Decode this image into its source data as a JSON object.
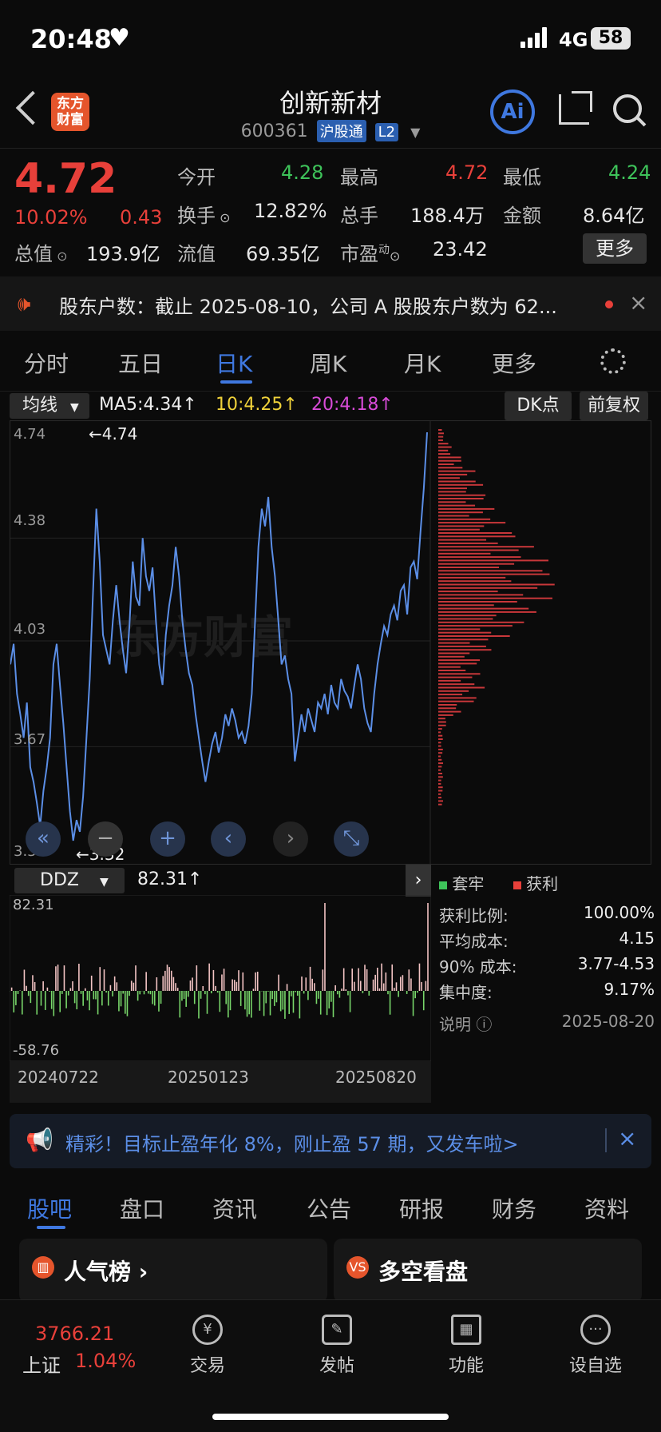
{
  "status": {
    "time": "20:48",
    "network": "4G",
    "battery": "58"
  },
  "header": {
    "name": "创新新材",
    "code": "600361",
    "badge1": "沪股通",
    "badge2": "L2",
    "logo_line1": "东方",
    "logo_line2": "财富",
    "ai_label": "Ai"
  },
  "quote": {
    "price": "4.72",
    "change_pct": "10.02%",
    "change": "0.43",
    "open_label": "今开",
    "open": "4.28",
    "high_label": "最高",
    "high": "4.72",
    "low_label": "最低",
    "low": "4.24",
    "turnover_label": "换手",
    "turnover": "12.82%",
    "volume_label": "总手",
    "volume": "188.4万",
    "amount_label": "金额",
    "amount": "8.64亿",
    "mktcap_label": "总值",
    "mktcap": "193.9亿",
    "float_label": "流值",
    "float": "69.35亿",
    "pe_label": "市盈",
    "pe_sup": "动",
    "pe": "23.42",
    "more": "更多"
  },
  "notice": {
    "text": "股东户数：截止 2025-08-10，公司 A 股股东户数为 62..."
  },
  "ktabs": [
    "分时",
    "五日",
    "日K",
    "周K",
    "月K",
    "更多"
  ],
  "ma": {
    "selector": "均线",
    "ma5": "MA5:4.34↑",
    "ma10": "10:4.25↑",
    "ma20": "20:4.18↑",
    "dk": "DK点",
    "adjust": "前复权"
  },
  "chart_data": {
    "type": "line",
    "y_ticks": [
      "4.74",
      "4.38",
      "4.03",
      "3.67",
      "3.32"
    ],
    "ylim": [
      3.32,
      4.74
    ],
    "max_marker": "←4.74",
    "min_marker": "←3.32",
    "watermark": "东方财富",
    "x_ticks": [
      "20240722",
      "20250123",
      "20250820"
    ],
    "series": [
      {
        "values": [
          3.95,
          4.02,
          3.85,
          3.78,
          3.7,
          3.82,
          3.6,
          3.55,
          3.48,
          3.4,
          3.52,
          3.6,
          3.7,
          3.95,
          4.02,
          3.88,
          3.75,
          3.6,
          3.45,
          3.35,
          3.42,
          3.38,
          3.5,
          3.7,
          3.9,
          4.2,
          4.48,
          4.3,
          4.05,
          4.0,
          3.95,
          4.1,
          4.22,
          4.1,
          4.0,
          3.92,
          4.08,
          4.3,
          4.18,
          4.15,
          4.38,
          4.25,
          4.2,
          4.28,
          4.1,
          3.95,
          3.88,
          4.05,
          4.15,
          4.22,
          4.35,
          4.25,
          4.1,
          4.0,
          3.92,
          3.88,
          3.78,
          3.7,
          3.62,
          3.55,
          3.62,
          3.68,
          3.72,
          3.65,
          3.7,
          3.78,
          3.74,
          3.8,
          3.76,
          3.7,
          3.72,
          3.68,
          3.74,
          3.85,
          4.1,
          4.35,
          4.48,
          4.42,
          4.52,
          4.35,
          4.25,
          4.1,
          3.95,
          3.98,
          3.9,
          3.85,
          3.62,
          3.7,
          3.78,
          3.72,
          3.8,
          3.76,
          3.72,
          3.82,
          3.8,
          3.85,
          3.78,
          3.88,
          3.82,
          3.8,
          3.9,
          3.86,
          3.84,
          3.8,
          3.88,
          3.95,
          3.9,
          3.8,
          3.75,
          3.72,
          3.85,
          3.95,
          4.02,
          4.08,
          4.05,
          4.12,
          4.15,
          4.1,
          4.2,
          4.22,
          4.12,
          4.28,
          4.3,
          4.24,
          4.4,
          4.55,
          4.74
        ]
      }
    ],
    "ddz": {
      "selector": "DDZ",
      "value": "82.31↑",
      "max": "82.31",
      "min": "-58.76"
    }
  },
  "chip_stats": {
    "legend_trap": "套牢",
    "legend_profit": "获利",
    "rows": [
      {
        "label": "获利比例:",
        "value": "100.00%"
      },
      {
        "label": "平均成本:",
        "value": "4.15"
      },
      {
        "label": "90% 成本:",
        "value": "3.77-4.53"
      },
      {
        "label": "集中度:",
        "value": "9.17%"
      }
    ],
    "note": "说明",
    "date": "2025-08-20"
  },
  "ad": {
    "text": "精彩！目标止盈年化 8%，刚止盈 57 期，又发车啦>"
  },
  "btabs": [
    "股吧",
    "盘口",
    "资讯",
    "公告",
    "研报",
    "财务",
    "资料"
  ],
  "cards": {
    "card1": "人气榜",
    "card2": "多空看盘"
  },
  "footer": {
    "index_value": "3766.21",
    "index_name": "上证",
    "index_pct": "1.04%",
    "items": [
      "交易",
      "发帖",
      "功能",
      "设自选"
    ]
  },
  "colors": {
    "accent": "#3f78e0",
    "up": "#e8403a",
    "down": "#3ec35a",
    "line": "#5b8ee6"
  }
}
